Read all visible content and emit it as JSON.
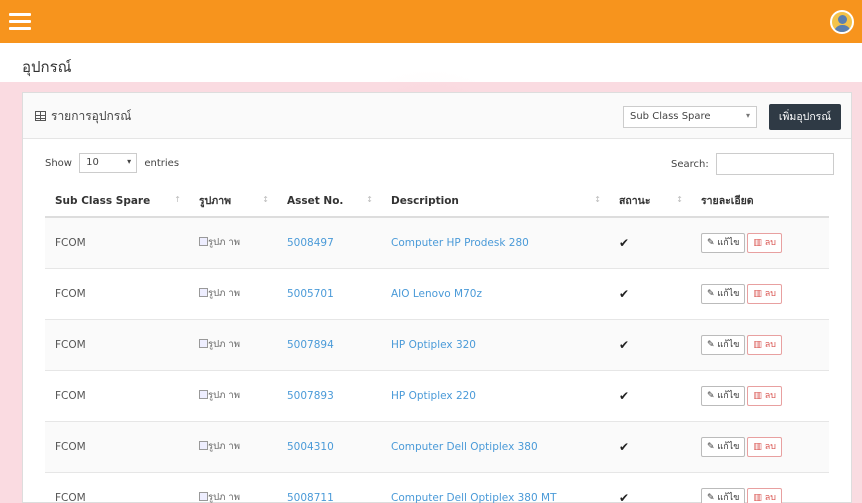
{
  "header": {
    "page_title": "อุปกรณ์"
  },
  "panel": {
    "title": "รายการอุปกรณ์",
    "filter_value": "Sub Class Spare",
    "add_button": "เพิ่มอุปกรณ์"
  },
  "table_controls": {
    "show_label": "Show",
    "page_length": "10",
    "entries_label": "entries",
    "search_label": "Search:"
  },
  "table": {
    "columns": [
      "Sub Class Spare",
      "รูปภาพ",
      "Asset No.",
      "Description",
      "สถานะ",
      "รายละเอียด"
    ],
    "rows": [
      {
        "sub_class": "FCOM",
        "image_alt": "รูปภ าพ",
        "asset_no": "5008497",
        "description": "Computer HP Prodesk 280",
        "status": "✔"
      },
      {
        "sub_class": "FCOM",
        "image_alt": "รูปภ าพ",
        "asset_no": "5005701",
        "description": "AIO Lenovo M70z",
        "status": "✔"
      },
      {
        "sub_class": "FCOM",
        "image_alt": "รูปภ าพ",
        "asset_no": "5007894",
        "description": "HP Optiplex 320",
        "status": "✔"
      },
      {
        "sub_class": "FCOM",
        "image_alt": "รูปภ าพ",
        "asset_no": "5007893",
        "description": "HP Optiplex 220",
        "status": "✔"
      },
      {
        "sub_class": "FCOM",
        "image_alt": "รูปภ าพ",
        "asset_no": "5004310",
        "description": "Computer Dell Optiplex 380",
        "status": "✔"
      },
      {
        "sub_class": "FCOM",
        "image_alt": "รูปภ าพ",
        "asset_no": "5008711",
        "description": "Computer Dell Optiplex 380 MT",
        "status": "✔"
      }
    ],
    "edit_label": "แก้ไข",
    "delete_label": "ลบ"
  }
}
